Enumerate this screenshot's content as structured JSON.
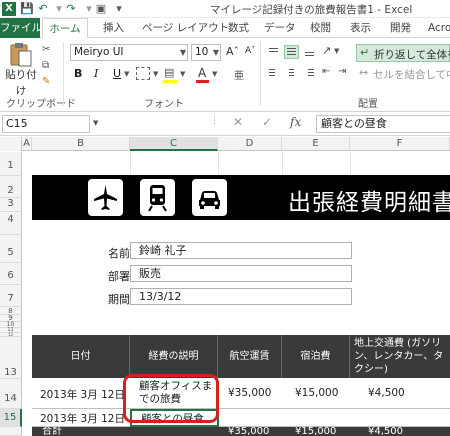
{
  "window": {
    "title": "マイレージ記録付きの旅費報告書1 - Excel",
    "app_logo": "X"
  },
  "quick_access": {
    "icons": [
      "save-icon",
      "undo-icon",
      "redo-icon",
      "print-preview-icon",
      "customize-icon"
    ]
  },
  "ribbon_tabs": [
    "ファイル",
    "ホーム",
    "挿入",
    "ページ レイアウト",
    "数式",
    "データ",
    "校閲",
    "表示",
    "開発",
    "Acro"
  ],
  "ribbon": {
    "clipboard": {
      "paste_label": "貼り付け",
      "group_label": "クリップボード"
    },
    "font": {
      "font_name": "Meiryo UI",
      "font_size": "10",
      "bold": "B",
      "italic": "I",
      "underline": "U",
      "font_color_glyph": "A",
      "group_label": "フォント"
    },
    "alignment": {
      "wrap_text": "折り返して全体を表",
      "merge_center": "セルを結合して中",
      "group_label": "配置"
    }
  },
  "formula_bar": {
    "name_box": "C15",
    "cancel_glyph": "✕",
    "enter_glyph": "✓",
    "fx_glyph": "fx",
    "value": "顧客との昼食"
  },
  "grid": {
    "columns": [
      "A",
      "B",
      "C",
      "D",
      "E",
      "F"
    ],
    "selected_column": "C",
    "rows": [
      "1",
      "2",
      "3",
      "4",
      "5",
      "6",
      "7",
      "8",
      "9",
      "10",
      "11",
      "12",
      "13",
      "14",
      "15"
    ],
    "selected_row": "15"
  },
  "sheet": {
    "banner_title": "出張経費明細書",
    "banner_icons": [
      "airplane-icon",
      "train-icon",
      "car-icon"
    ],
    "fields": [
      {
        "label": "名前",
        "value": "鈴崎 礼子"
      },
      {
        "label": "部署",
        "value": "販売"
      },
      {
        "label": "期間",
        "value": "13/3/12"
      }
    ],
    "table": {
      "headers": [
        "日付",
        "経費の説明",
        "航空運賃",
        "宿泊費",
        "地上交通費 (ガソリン、レンタカー、タクシー)"
      ],
      "rows": [
        [
          "2013年 3月 12日",
          "顧客オフィスまでの旅費",
          "¥35,000",
          "¥15,000",
          "¥4,500"
        ],
        [
          "2013年 3月 12日",
          "顧客との昼食",
          "",
          "",
          ""
        ],
        [
          "合計",
          "",
          "¥35,000",
          "¥15,000",
          "¥4,500"
        ]
      ]
    },
    "highlight_color": "#d62020"
  },
  "colors": {
    "excel_green": "#217346",
    "header_dark": "#3a3a3a",
    "banner_black": "#000000"
  }
}
